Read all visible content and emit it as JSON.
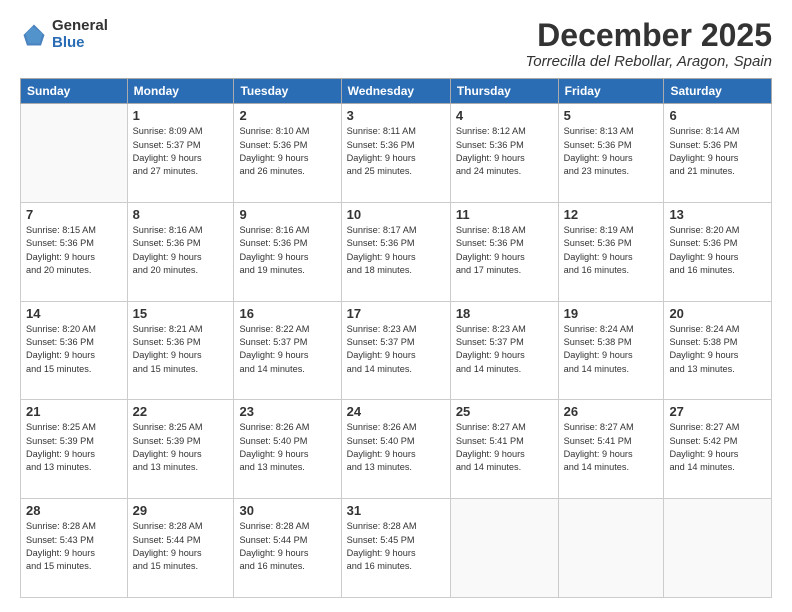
{
  "logo": {
    "general": "General",
    "blue": "Blue"
  },
  "title": {
    "month": "December 2025",
    "location": "Torrecilla del Rebollar, Aragon, Spain"
  },
  "days_of_week": [
    "Sunday",
    "Monday",
    "Tuesday",
    "Wednesday",
    "Thursday",
    "Friday",
    "Saturday"
  ],
  "weeks": [
    [
      {
        "day": "",
        "info": ""
      },
      {
        "day": "1",
        "info": "Sunrise: 8:09 AM\nSunset: 5:37 PM\nDaylight: 9 hours\nand 27 minutes."
      },
      {
        "day": "2",
        "info": "Sunrise: 8:10 AM\nSunset: 5:36 PM\nDaylight: 9 hours\nand 26 minutes."
      },
      {
        "day": "3",
        "info": "Sunrise: 8:11 AM\nSunset: 5:36 PM\nDaylight: 9 hours\nand 25 minutes."
      },
      {
        "day": "4",
        "info": "Sunrise: 8:12 AM\nSunset: 5:36 PM\nDaylight: 9 hours\nand 24 minutes."
      },
      {
        "day": "5",
        "info": "Sunrise: 8:13 AM\nSunset: 5:36 PM\nDaylight: 9 hours\nand 23 minutes."
      },
      {
        "day": "6",
        "info": "Sunrise: 8:14 AM\nSunset: 5:36 PM\nDaylight: 9 hours\nand 21 minutes."
      }
    ],
    [
      {
        "day": "7",
        "info": "Sunrise: 8:15 AM\nSunset: 5:36 PM\nDaylight: 9 hours\nand 20 minutes."
      },
      {
        "day": "8",
        "info": "Sunrise: 8:16 AM\nSunset: 5:36 PM\nDaylight: 9 hours\nand 20 minutes."
      },
      {
        "day": "9",
        "info": "Sunrise: 8:16 AM\nSunset: 5:36 PM\nDaylight: 9 hours\nand 19 minutes."
      },
      {
        "day": "10",
        "info": "Sunrise: 8:17 AM\nSunset: 5:36 PM\nDaylight: 9 hours\nand 18 minutes."
      },
      {
        "day": "11",
        "info": "Sunrise: 8:18 AM\nSunset: 5:36 PM\nDaylight: 9 hours\nand 17 minutes."
      },
      {
        "day": "12",
        "info": "Sunrise: 8:19 AM\nSunset: 5:36 PM\nDaylight: 9 hours\nand 16 minutes."
      },
      {
        "day": "13",
        "info": "Sunrise: 8:20 AM\nSunset: 5:36 PM\nDaylight: 9 hours\nand 16 minutes."
      }
    ],
    [
      {
        "day": "14",
        "info": "Sunrise: 8:20 AM\nSunset: 5:36 PM\nDaylight: 9 hours\nand 15 minutes."
      },
      {
        "day": "15",
        "info": "Sunrise: 8:21 AM\nSunset: 5:36 PM\nDaylight: 9 hours\nand 15 minutes."
      },
      {
        "day": "16",
        "info": "Sunrise: 8:22 AM\nSunset: 5:37 PM\nDaylight: 9 hours\nand 14 minutes."
      },
      {
        "day": "17",
        "info": "Sunrise: 8:23 AM\nSunset: 5:37 PM\nDaylight: 9 hours\nand 14 minutes."
      },
      {
        "day": "18",
        "info": "Sunrise: 8:23 AM\nSunset: 5:37 PM\nDaylight: 9 hours\nand 14 minutes."
      },
      {
        "day": "19",
        "info": "Sunrise: 8:24 AM\nSunset: 5:38 PM\nDaylight: 9 hours\nand 14 minutes."
      },
      {
        "day": "20",
        "info": "Sunrise: 8:24 AM\nSunset: 5:38 PM\nDaylight: 9 hours\nand 13 minutes."
      }
    ],
    [
      {
        "day": "21",
        "info": "Sunrise: 8:25 AM\nSunset: 5:39 PM\nDaylight: 9 hours\nand 13 minutes."
      },
      {
        "day": "22",
        "info": "Sunrise: 8:25 AM\nSunset: 5:39 PM\nDaylight: 9 hours\nand 13 minutes."
      },
      {
        "day": "23",
        "info": "Sunrise: 8:26 AM\nSunset: 5:40 PM\nDaylight: 9 hours\nand 13 minutes."
      },
      {
        "day": "24",
        "info": "Sunrise: 8:26 AM\nSunset: 5:40 PM\nDaylight: 9 hours\nand 13 minutes."
      },
      {
        "day": "25",
        "info": "Sunrise: 8:27 AM\nSunset: 5:41 PM\nDaylight: 9 hours\nand 14 minutes."
      },
      {
        "day": "26",
        "info": "Sunrise: 8:27 AM\nSunset: 5:41 PM\nDaylight: 9 hours\nand 14 minutes."
      },
      {
        "day": "27",
        "info": "Sunrise: 8:27 AM\nSunset: 5:42 PM\nDaylight: 9 hours\nand 14 minutes."
      }
    ],
    [
      {
        "day": "28",
        "info": "Sunrise: 8:28 AM\nSunset: 5:43 PM\nDaylight: 9 hours\nand 15 minutes."
      },
      {
        "day": "29",
        "info": "Sunrise: 8:28 AM\nSunset: 5:44 PM\nDaylight: 9 hours\nand 15 minutes."
      },
      {
        "day": "30",
        "info": "Sunrise: 8:28 AM\nSunset: 5:44 PM\nDaylight: 9 hours\nand 16 minutes."
      },
      {
        "day": "31",
        "info": "Sunrise: 8:28 AM\nSunset: 5:45 PM\nDaylight: 9 hours\nand 16 minutes."
      },
      {
        "day": "",
        "info": ""
      },
      {
        "day": "",
        "info": ""
      },
      {
        "day": "",
        "info": ""
      }
    ]
  ]
}
